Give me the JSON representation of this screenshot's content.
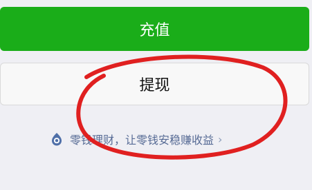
{
  "buttons": {
    "recharge_label": "充值",
    "withdraw_label": "提现"
  },
  "promo": {
    "icon": "lingqiantong-icon",
    "text": "零钱理财，让零钱安稳赚收益",
    "chevron": "›"
  },
  "colors": {
    "primary_green": "#1aad19",
    "page_bg": "#efeff4",
    "link_blue": "#576b95",
    "annotation_red": "#e02020"
  }
}
